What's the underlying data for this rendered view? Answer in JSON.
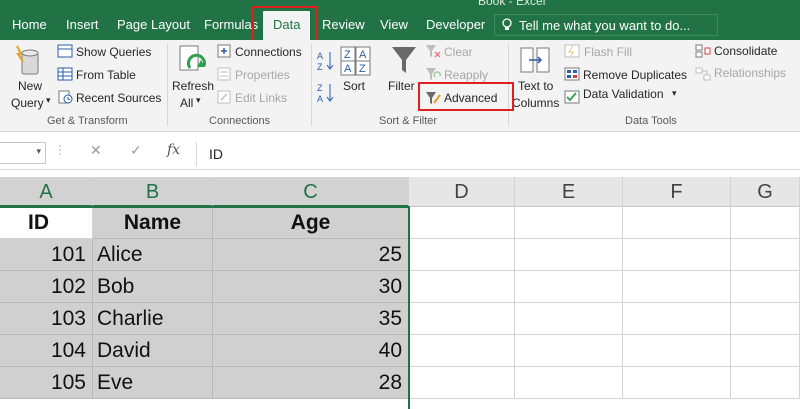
{
  "window": {
    "title": "Book - Excel"
  },
  "tabs": [
    {
      "label": "Home",
      "active": false
    },
    {
      "label": "Insert",
      "active": false
    },
    {
      "label": "Page Layout",
      "active": false
    },
    {
      "label": "Formulas",
      "active": false
    },
    {
      "label": "Data",
      "active": true
    },
    {
      "label": "Review",
      "active": false
    },
    {
      "label": "View",
      "active": false
    },
    {
      "label": "Developer",
      "active": false
    }
  ],
  "tell_me": {
    "placeholder": "Tell me what you want to do..."
  },
  "ribbon": {
    "get_transform": {
      "label": "Get & Transform",
      "new_query": [
        "New",
        "Query"
      ],
      "show_queries": "Show Queries",
      "from_table": "From Table",
      "recent_sources": "Recent Sources"
    },
    "connections": {
      "label": "Connections",
      "refresh_all": [
        "Refresh",
        "All"
      ],
      "connections": "Connections",
      "properties": "Properties",
      "edit_links": "Edit Links"
    },
    "sort_filter": {
      "label": "Sort & Filter",
      "sort": "Sort",
      "filter": "Filter",
      "clear": "Clear",
      "reapply": "Reapply",
      "advanced": "Advanced"
    },
    "data_tools": {
      "label": "Data Tools",
      "text_to_columns": [
        "Text to",
        "Columns"
      ],
      "flash_fill": "Flash Fill",
      "remove_duplicates": "Remove Duplicates",
      "data_validation": "Data Validation",
      "consolidate": "Consolidate",
      "relationships": "Relationships"
    }
  },
  "formula_bar": {
    "fx": "fx",
    "value": "ID"
  },
  "grid": {
    "columns": [
      "A",
      "B",
      "C",
      "D",
      "E",
      "F",
      "G"
    ],
    "header_row": [
      "ID",
      "Name",
      "Age"
    ],
    "rows": [
      [
        "101",
        "Alice",
        "25"
      ],
      [
        "102",
        "Bob",
        "30"
      ],
      [
        "103",
        "Charlie",
        "35"
      ],
      [
        "104",
        "David",
        "40"
      ],
      [
        "105",
        "Eve",
        "28"
      ]
    ]
  },
  "colors": {
    "excel_green": "#217346",
    "highlight_red": "#e02020",
    "selection_gray": "#d0d0d0"
  }
}
